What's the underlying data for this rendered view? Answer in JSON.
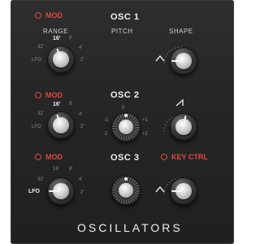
{
  "panel": {
    "footer": "OSCILLATORS"
  },
  "osc1": {
    "title": "OSC 1",
    "mod_label": "MOD",
    "range_label": "RANGE",
    "pitch_label": "PITCH",
    "shape_label": "SHAPE",
    "range_ticks": [
      "32'",
      "16'",
      "8'",
      "4'",
      "2'",
      "LFO"
    ],
    "range_selected": "16'"
  },
  "osc2": {
    "title": "OSC 2",
    "mod_label": "MOD",
    "range_ticks": [
      "32'",
      "16'",
      "8'",
      "4'",
      "2'",
      "LFO"
    ],
    "range_selected": "16'",
    "pitch_ticks": [
      "-2",
      "-1",
      "0",
      "+1",
      "+2"
    ]
  },
  "osc3": {
    "title": "OSC 3",
    "mod_label": "MOD",
    "keyctrl_label": "KEY CTRL",
    "range_ticks": [
      "32'",
      "16'",
      "8'",
      "4'",
      "2'",
      "LFO"
    ],
    "range_selected": "LFO"
  },
  "colors": {
    "accent": "#e04a3c",
    "panel": "#262626"
  }
}
